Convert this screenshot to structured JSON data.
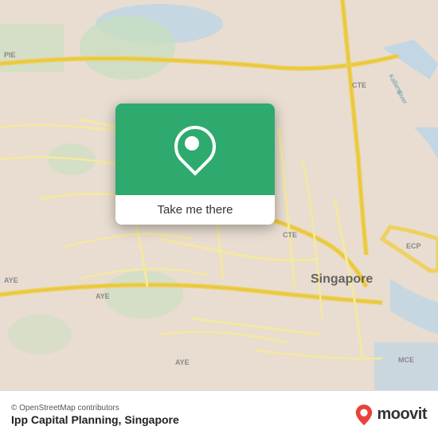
{
  "map": {
    "background_color": "#e8e0d8"
  },
  "popup": {
    "button_label": "Take me there",
    "icon_alt": "location-pin"
  },
  "bottom_bar": {
    "osm_credit": "© OpenStreetMap contributors",
    "place_name": "Ipp Capital Planning, Singapore",
    "moovit_label": "moovit"
  }
}
